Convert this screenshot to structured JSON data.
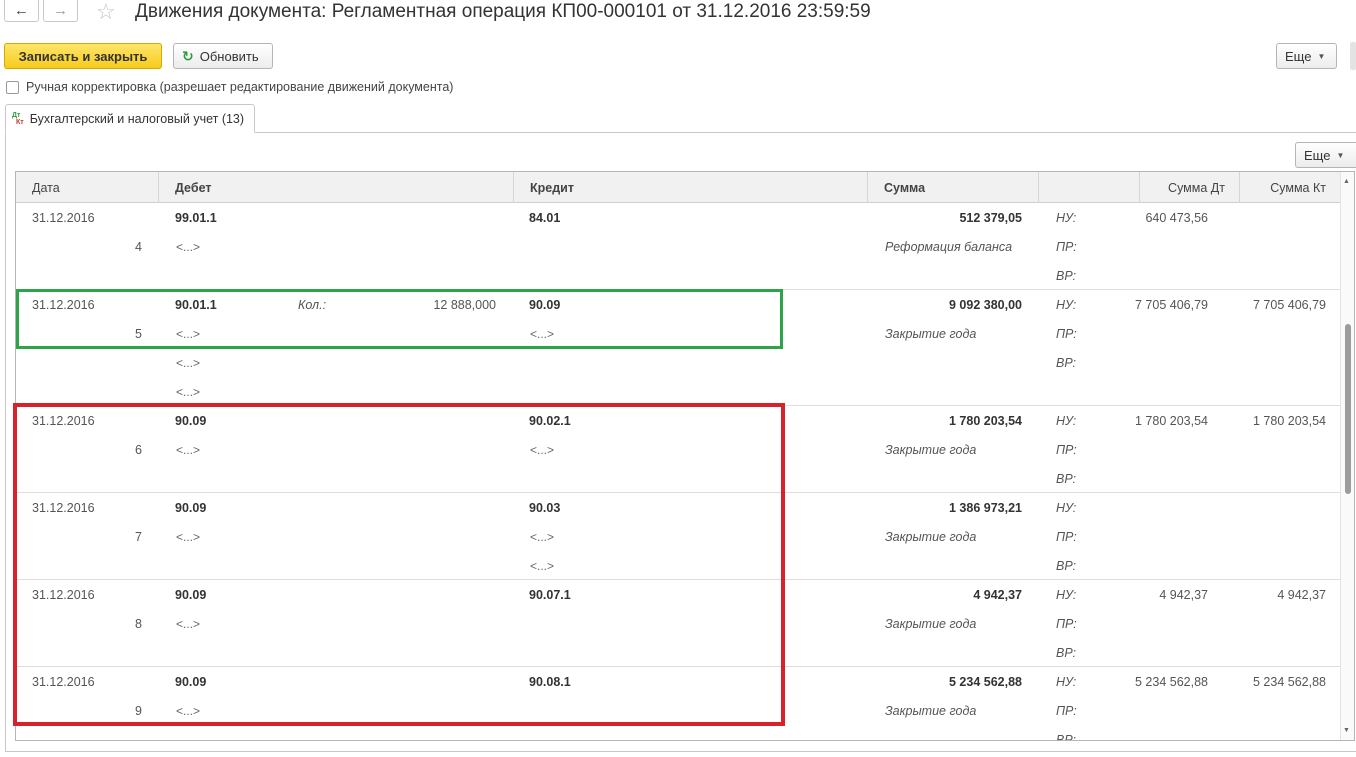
{
  "window": {
    "title": "Движения документа: Регламентная операция КП00-000101 от 31.12.2016 23:59:59"
  },
  "nav": {
    "back_icon": "arrow-left-icon",
    "forward_icon": "arrow-right-icon",
    "favorite_icon": "star-icon"
  },
  "toolbar": {
    "save_close_label": "Записать и закрыть",
    "refresh_label": "Обновить",
    "more_label": "Еще"
  },
  "manual_correction": {
    "label": "Ручная корректировка (разрешает редактирование движений документа)",
    "checked": false
  },
  "tab": {
    "icon_top": "Дт",
    "icon_bottom": "Кт",
    "label": "Бухгалтерский и налоговый учет (13)"
  },
  "grid": {
    "more_label": "Еще",
    "columns": {
      "date": "Дата",
      "debit": "Дебет",
      "credit": "Кредит",
      "sum": "Сумма",
      "blank": "",
      "sum_dt": "Сумма Дт",
      "sum_kt": "Сумма Кт"
    },
    "records": [
      {
        "date": "31.12.2016",
        "num": "4",
        "debit": "99.01.1",
        "debit_qty_label": "",
        "debit_qty": "",
        "debit_subs": [
          "<...>"
        ],
        "credit": "84.01",
        "credit_subs": [],
        "sum": "512 379,05",
        "content": "Реформация баланса",
        "tax_labels": [
          "НУ:",
          "ПР:",
          "ВР:"
        ],
        "sum_dt": "640 473,56",
        "sum_kt": ""
      },
      {
        "date": "31.12.2016",
        "num": "5",
        "debit": "90.01.1",
        "debit_qty_label": "Кол.:",
        "debit_qty": "12 888,000",
        "debit_subs": [
          "<...>",
          "<...>",
          "<...>"
        ],
        "credit": "90.09",
        "credit_subs": [
          "<...>"
        ],
        "sum": "9 092 380,00",
        "content": "Закрытие года",
        "tax_labels": [
          "НУ:",
          "ПР:",
          "ВР:"
        ],
        "sum_dt": "7 705 406,79",
        "sum_kt": "7 705 406,79"
      },
      {
        "date": "31.12.2016",
        "num": "6",
        "debit": "90.09",
        "debit_qty_label": "",
        "debit_qty": "",
        "debit_subs": [
          "<...>"
        ],
        "credit": "90.02.1",
        "credit_subs": [
          "<...>"
        ],
        "sum": "1 780 203,54",
        "content": "Закрытие года",
        "tax_labels": [
          "НУ:",
          "ПР:",
          "ВР:"
        ],
        "sum_dt": "1 780 203,54",
        "sum_kt": "1 780 203,54"
      },
      {
        "date": "31.12.2016",
        "num": "7",
        "debit": "90.09",
        "debit_qty_label": "",
        "debit_qty": "",
        "debit_subs": [
          "<...>"
        ],
        "credit": "90.03",
        "credit_subs": [
          "<...>",
          "<...>"
        ],
        "sum": "1 386 973,21",
        "content": "Закрытие года",
        "tax_labels": [
          "НУ:",
          "ПР:",
          "ВР:"
        ],
        "sum_dt": "",
        "sum_kt": ""
      },
      {
        "date": "31.12.2016",
        "num": "8",
        "debit": "90.09",
        "debit_qty_label": "",
        "debit_qty": "",
        "debit_subs": [
          "<...>"
        ],
        "credit": "90.07.1",
        "credit_subs": [],
        "sum": "4 942,37",
        "content": "Закрытие года",
        "tax_labels": [
          "НУ:",
          "ПР:",
          "ВР:"
        ],
        "sum_dt": "4 942,37",
        "sum_kt": "4 942,37"
      },
      {
        "date": "31.12.2016",
        "num": "9",
        "debit": "90.09",
        "debit_qty_label": "",
        "debit_qty": "",
        "debit_subs": [
          "<...>"
        ],
        "credit": "90.08.1",
        "credit_subs": [],
        "sum": "5 234 562,88",
        "content": "Закрытие года",
        "tax_labels": [
          "НУ:",
          "ПР:",
          "ВР:"
        ],
        "sum_dt": "5 234 562,88",
        "sum_kt": "5 234 562,88"
      }
    ]
  },
  "highlights": {
    "green": "#2ea34a",
    "red": "#d6232b"
  }
}
